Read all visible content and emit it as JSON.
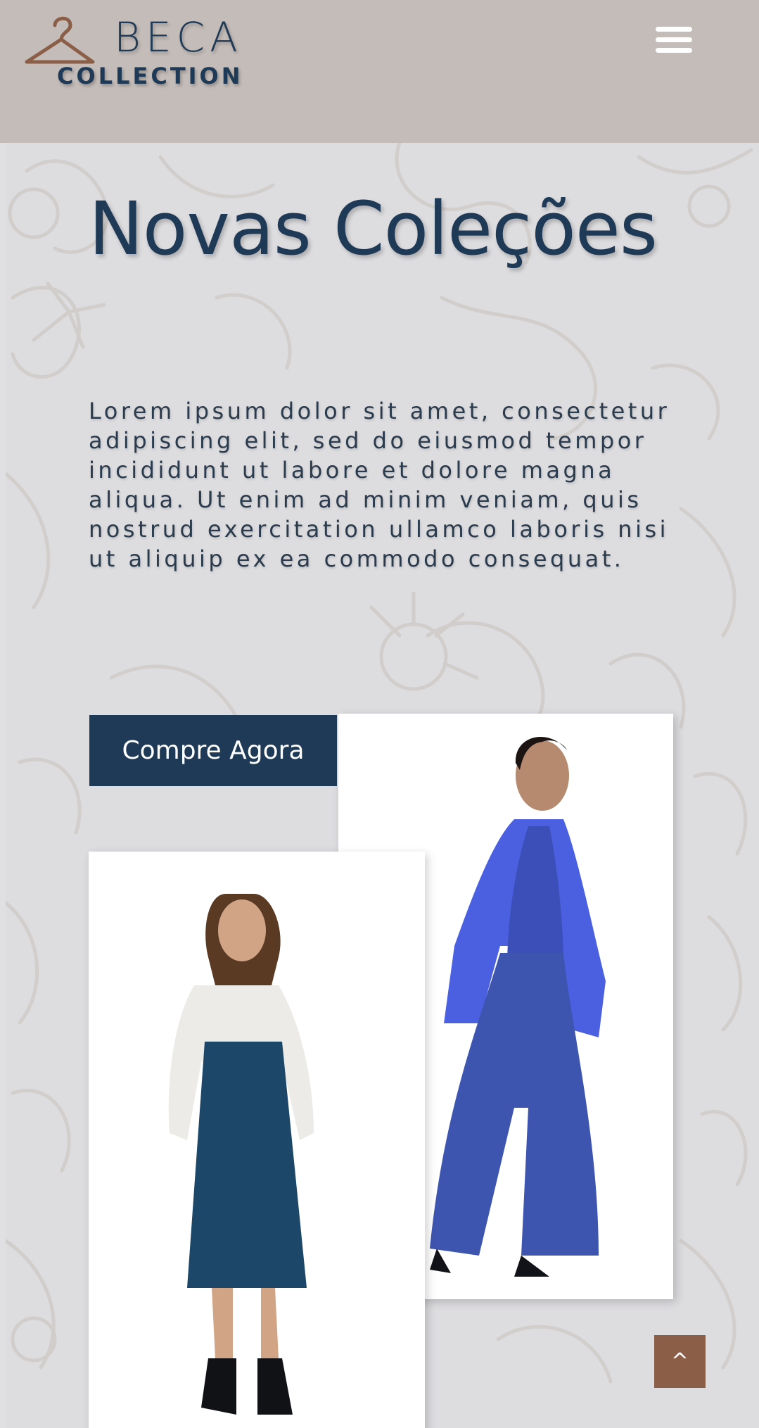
{
  "brand": {
    "logo_word": "BECA",
    "logo_sub": "COLLECTION",
    "colors": {
      "navy": "#1e3a56",
      "brown": "#8b5e48",
      "header_bg": "#c4bcb8"
    }
  },
  "header": {
    "menu_icon": "hamburger-menu-icon"
  },
  "hero": {
    "title": "Novas Coleções",
    "description": "Lorem ipsum dolor sit amet, consectetur adipiscing elit, sed do eiusmod tempor incididunt ut labore et dolore magna aliqua. Ut enim ad minim veniam, quis nostrud exercitation ullamco laboris nisi ut aliquip ex ea commodo consequat.",
    "cta_label": "Compre Agora"
  },
  "scroll_top": {
    "label": "^"
  }
}
